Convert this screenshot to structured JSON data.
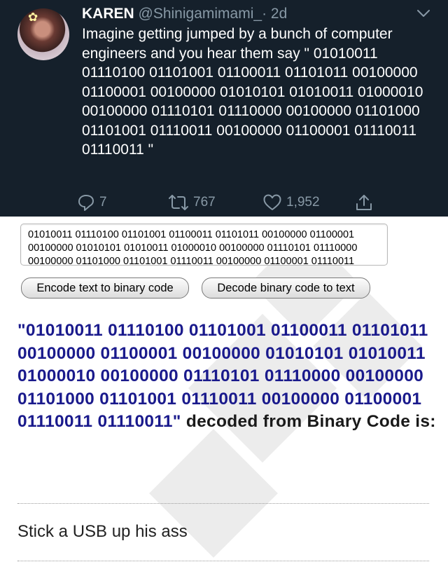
{
  "tweet": {
    "name": "KAREN",
    "handle": "@Shinigamimami_",
    "time": "· 2d",
    "text": "Imagine getting jumped by a bunch of computer engineers and you hear them say \" 01010011 01110100 01101001 01100011 01101011 00100000 01100001 00100000 01010101 01010011 01000010 00100000 01110101 01110000 00100000 01101000 01101001 01110011 00100000 01100001 01110011 01110011 \"",
    "reply_count": "7",
    "retweet_count": "767",
    "like_count": "1,952"
  },
  "translator": {
    "input_value": "01010011 01110100 01101001 01100011 01101011 00100000 01100001 00100000 01010101 01010011 01000010 00100000 01110101 01110000 00100000 01101000 01101001 01110011 00100000 01100001 01110011 01110011",
    "encode_button": "Encode text to binary code",
    "decode_button": "Decode binary code to text",
    "decoded_binary": "\"01010011 01110100 01101001 01100011 01101011 00100000 01100001 00100000 01010101 01010011 01000010 00100000 01110101 01110000 00100000 01101000 01101001 01110011 00100000 01100001 01110011 01110011\"",
    "decoded_suffix": " decoded from Binary Code is:",
    "result_text": "Stick a USB up his ass"
  },
  "colors": {
    "tweet_background": "#15202b",
    "secondary_text": "#8899a6",
    "binary_text": "#1a1a8c"
  }
}
